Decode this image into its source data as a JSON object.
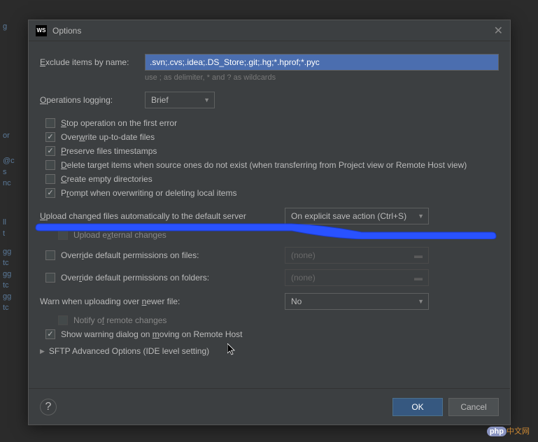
{
  "titlebar": {
    "appIcon": "WS",
    "title": "Options"
  },
  "exclude": {
    "label": "Exclude items by name:",
    "value": ".svn;.cvs;.idea;.DS_Store;.git;.hg;*.hprof;*.pyc",
    "helper": "use ; as delimiter, * and ? as wildcards"
  },
  "operationsLogging": {
    "label": "Operations logging:",
    "value": "Brief"
  },
  "checkboxes": {
    "stopOnError": {
      "label": "Stop operation on the first error",
      "checked": false
    },
    "overwrite": {
      "label": "Overwrite up-to-date files",
      "checked": true
    },
    "preserve": {
      "label": "Preserve files timestamps",
      "checked": true
    },
    "deleteTarget": {
      "label": "Delete target items when source ones do not exist (when transferring from Project view or Remote Host view)",
      "checked": false
    },
    "createEmpty": {
      "label": "Create empty directories",
      "checked": false
    },
    "prompt": {
      "label": "Prompt when overwriting or deleting local items",
      "checked": true
    },
    "uploadExternal": {
      "label": "Upload external changes",
      "checked": false
    },
    "overrideFiles": {
      "label": "Override default permissions on files:",
      "checked": false
    },
    "overrideFolders": {
      "label": "Override default permissions on folders:",
      "checked": false
    },
    "notifyRemote": {
      "label": "Notify of remote changes",
      "checked": false
    },
    "showWarning": {
      "label": "Show warning dialog on moving on Remote Host",
      "checked": true
    }
  },
  "uploadChanged": {
    "label": "Upload changed files automatically to the default server",
    "value": "On explicit save action (Ctrl+S)"
  },
  "permissions": {
    "filesValue": "(none)",
    "foldersValue": "(none)"
  },
  "warnNewer": {
    "label": "Warn when uploading over newer file:",
    "value": "No"
  },
  "sftp": {
    "label": "SFTP Advanced Options (IDE level setting)"
  },
  "footer": {
    "help": "?",
    "ok": "OK",
    "cancel": "Cancel"
  },
  "watermark": {
    "php": "php",
    "cn": "中文网"
  }
}
